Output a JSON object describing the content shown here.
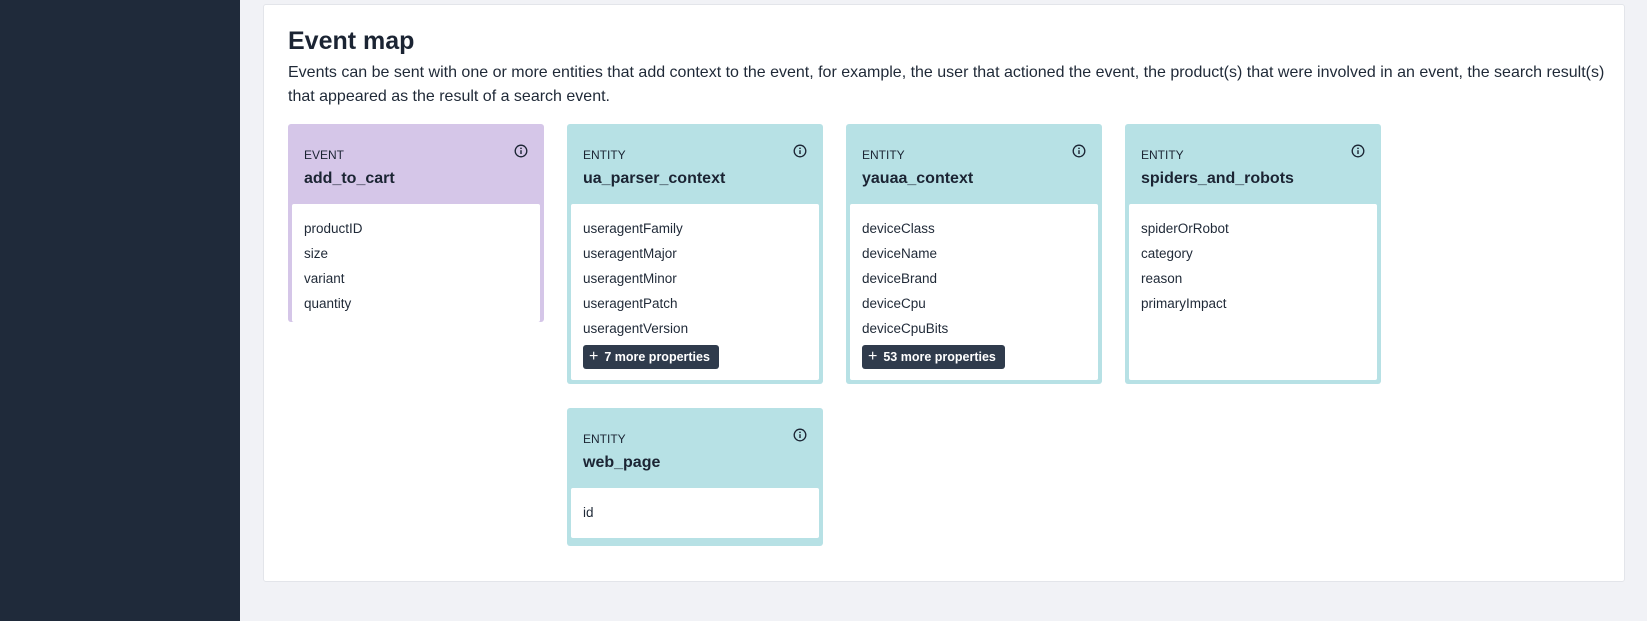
{
  "event_map": {
    "title": "Event map",
    "description": "Events can be sent with one or more entities that add context to the event, for example, the user that actioned the event, the product(s) that were involved in an event, the search result(s) that appeared as the result of a search event."
  },
  "cards": [
    {
      "kind": "EVENT",
      "name": "add_to_cart",
      "properties": [
        "productID",
        "size",
        "variant",
        "quantity"
      ]
    },
    {
      "kind": "ENTITY",
      "name": "ua_parser_context",
      "properties": [
        "useragentFamily",
        "useragentMajor",
        "useragentMinor",
        "useragentPatch",
        "useragentVersion"
      ],
      "more_label": "7 more properties"
    },
    {
      "kind": "ENTITY",
      "name": "yauaa_context",
      "properties": [
        "deviceClass",
        "deviceName",
        "deviceBrand",
        "deviceCpu",
        "deviceCpuBits"
      ],
      "more_label": "53 more properties"
    },
    {
      "kind": "ENTITY",
      "name": "spiders_and_robots",
      "properties": [
        "spiderOrRobot",
        "category",
        "reason",
        "primaryImpact"
      ]
    },
    {
      "kind": "ENTITY",
      "name": "web_page",
      "properties": [
        "id"
      ]
    }
  ],
  "colors": {
    "sidebar": "#1f2a3a",
    "event_card": "#d5c6e8",
    "entity_card": "#b7e1e5",
    "button": "#2f3b4c"
  },
  "icons": {
    "card_info": "info-icon",
    "more_button": "plus-icon"
  }
}
